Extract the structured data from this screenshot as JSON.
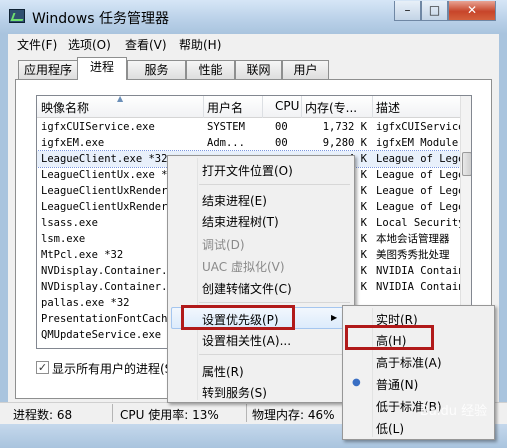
{
  "window": {
    "title": "Windows 任务管理器",
    "min_label": "–",
    "max_label": "□",
    "close_label": "✕"
  },
  "menu": {
    "file": "文件(F)",
    "options": "选项(O)",
    "view": "查看(V)",
    "help": "帮助(H)"
  },
  "tabs": [
    "应用程序",
    "进程",
    "服务",
    "性能",
    "联网",
    "用户"
  ],
  "columns": {
    "name": "映像名称",
    "user": "用户名",
    "cpu": "CPU",
    "mem": "内存(专...",
    "desc": "描述"
  },
  "rows": [
    {
      "name": "igfxCUIService.exe",
      "user": "SYSTEM",
      "cpu": "00",
      "mem": "1,732 K",
      "desc": "igfxCUIService"
    },
    {
      "name": "igfxEM.exe",
      "user": "Adm...",
      "cpu": "00",
      "mem": "9,280 K",
      "desc": "igfxEM Module"
    },
    {
      "name": "LeagueClient.exe *32",
      "user": "",
      "cpu": "",
      "mem": "4 K",
      "desc": "League of Lege"
    },
    {
      "name": "LeagueClientUx.exe *3",
      "user": "",
      "cpu": "",
      "mem": "0 K",
      "desc": "League of Lege"
    },
    {
      "name": "LeagueClientUxRender.",
      "user": "",
      "cpu": "",
      "mem": "0 K",
      "desc": "League of Lege"
    },
    {
      "name": "LeagueClientUxRender.",
      "user": "",
      "cpu": "",
      "mem": "0 K",
      "desc": "League of Lege"
    },
    {
      "name": "lsass.exe",
      "user": "",
      "cpu": "",
      "mem": "6 K",
      "desc": "Local Security"
    },
    {
      "name": "lsm.exe",
      "user": "",
      "cpu": "",
      "mem": "6 K",
      "desc": "本地会话管理器"
    },
    {
      "name": "MtPcl.exe *32",
      "user": "",
      "cpu": "",
      "mem": "0 K",
      "desc": "美图秀秀批处理"
    },
    {
      "name": "NVDisplay.Container.e",
      "user": "",
      "cpu": "",
      "mem": "0 K",
      "desc": "NVIDIA Contain"
    },
    {
      "name": "NVDisplay.Container.e",
      "user": "",
      "cpu": "",
      "mem": "0 K",
      "desc": "NVIDIA Contain"
    },
    {
      "name": "pallas.exe *32",
      "user": "",
      "cpu": "",
      "mem": "",
      "desc": ""
    },
    {
      "name": "PresentationFontCache",
      "user": "",
      "cpu": "",
      "mem": "",
      "desc": ""
    },
    {
      "name": "QMUpdateService.exe",
      "user": "",
      "cpu": "",
      "mem": "",
      "desc": ""
    }
  ],
  "show_all_label": "显示所有用户的进程(S)",
  "show_all_checked": "✓",
  "status": {
    "processes": "进程数: 68",
    "cpu": "CPU 使用率: 13%",
    "memory": "物理内存: 46%"
  },
  "context_menu": {
    "items": [
      "打开文件位置(O)",
      "结束进程(E)",
      "结束进程树(T)",
      "调试(D)",
      "UAC 虚拟化(V)",
      "创建转储文件(C)",
      "设置优先级(P)",
      "设置相关性(A)...",
      "属性(R)",
      "转到服务(S)"
    ],
    "arrow": "▶"
  },
  "priority_menu": {
    "items": [
      "实时(R)",
      "高(H)",
      "高于标准(A)",
      "普通(N)",
      "低于标准(B)",
      "低(L)"
    ],
    "selected_bullet": "●"
  },
  "watermark": "Baidu 经验",
  "colors": {
    "selection_red": "#b11a1a",
    "title_gradient": "#b9d0e8",
    "close_button": "#c7452a"
  }
}
